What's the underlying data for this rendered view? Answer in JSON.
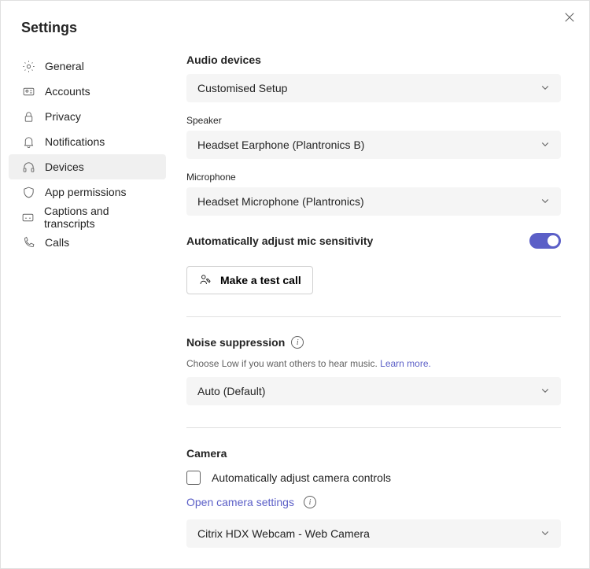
{
  "title": "Settings",
  "nav": {
    "items": [
      {
        "label": "General"
      },
      {
        "label": "Accounts"
      },
      {
        "label": "Privacy"
      },
      {
        "label": "Notifications"
      },
      {
        "label": "Devices"
      },
      {
        "label": "App permissions"
      },
      {
        "label": "Captions and transcripts"
      },
      {
        "label": "Calls"
      }
    ]
  },
  "audio": {
    "heading": "Audio devices",
    "device_value": "Customised Setup",
    "speaker_label": "Speaker",
    "speaker_value": "Headset Earphone (Plantronics B)",
    "mic_label": "Microphone",
    "mic_value": "Headset Microphone (Plantronics)",
    "sensitivity_label": "Automatically adjust mic sensitivity",
    "sensitivity_on": true,
    "test_call_label": "Make a test call"
  },
  "noise": {
    "heading": "Noise suppression",
    "help": "Choose Low if you want others to hear music.",
    "learn_more": "Learn more.",
    "value": "Auto (Default)"
  },
  "camera": {
    "heading": "Camera",
    "auto_adjust_label": "Automatically adjust camera controls",
    "auto_adjust_checked": false,
    "open_settings_label": "Open camera settings",
    "value": "Citrix HDX Webcam - Web Camera"
  }
}
